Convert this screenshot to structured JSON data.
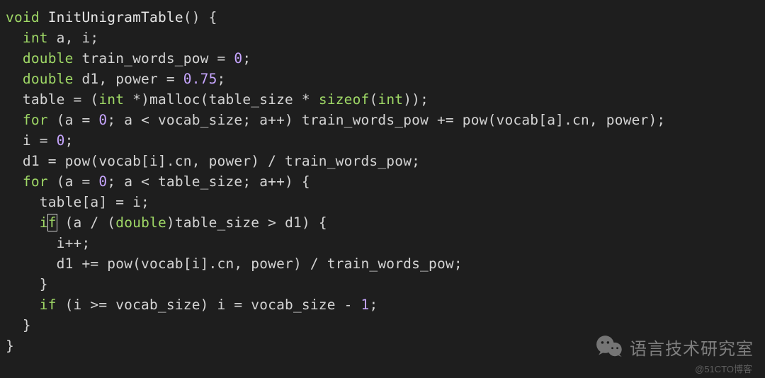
{
  "code": {
    "lines": [
      {
        "indent": 0,
        "tokens": [
          {
            "t": "void",
            "c": "kw"
          },
          {
            "t": " "
          },
          {
            "t": "InitUnigramTable",
            "c": "fn"
          },
          {
            "t": "()",
            "c": "punc"
          },
          {
            "t": " {",
            "c": "punc"
          }
        ]
      },
      {
        "indent": 1,
        "tokens": [
          {
            "t": "int",
            "c": "kw"
          },
          {
            "t": " a, i;"
          }
        ]
      },
      {
        "indent": 1,
        "tokens": [
          {
            "t": "double",
            "c": "kw"
          },
          {
            "t": " train_words_pow = "
          },
          {
            "t": "0",
            "c": "num"
          },
          {
            "t": ";"
          }
        ]
      },
      {
        "indent": 1,
        "tokens": [
          {
            "t": "double",
            "c": "kw"
          },
          {
            "t": " d1, power = "
          },
          {
            "t": "0.75",
            "c": "num"
          },
          {
            "t": ";"
          }
        ]
      },
      {
        "indent": 1,
        "tokens": [
          {
            "t": "table = ("
          },
          {
            "t": "int",
            "c": "kw"
          },
          {
            "t": " *)malloc(table_size * "
          },
          {
            "t": "sizeof",
            "c": "kw"
          },
          {
            "t": "("
          },
          {
            "t": "int",
            "c": "kw"
          },
          {
            "t": "));"
          }
        ]
      },
      {
        "indent": 1,
        "tokens": [
          {
            "t": "for",
            "c": "kw"
          },
          {
            "t": " (a = "
          },
          {
            "t": "0",
            "c": "num"
          },
          {
            "t": "; a < vocab_size; a++) train_words_pow += pow(vocab[a].cn, power);"
          }
        ]
      },
      {
        "indent": 1,
        "tokens": [
          {
            "t": "i = "
          },
          {
            "t": "0",
            "c": "num"
          },
          {
            "t": ";"
          }
        ]
      },
      {
        "indent": 1,
        "tokens": [
          {
            "t": "d1 = pow(vocab[i].cn, power) / train_words_pow;"
          }
        ]
      },
      {
        "indent": 1,
        "tokens": [
          {
            "t": "for",
            "c": "kw"
          },
          {
            "t": " (a = "
          },
          {
            "t": "0",
            "c": "num"
          },
          {
            "t": "; a < table_size; a++) {"
          }
        ]
      },
      {
        "indent": 2,
        "tokens": [
          {
            "t": "table[a] = i;"
          }
        ]
      },
      {
        "indent": 2,
        "tokens": [
          {
            "t": "i",
            "c": "kw"
          },
          {
            "t": "f",
            "c": "kw",
            "cursor": true
          },
          {
            "t": " (a / ("
          },
          {
            "t": "double",
            "c": "kw"
          },
          {
            "t": ")table_size > d1) {"
          }
        ]
      },
      {
        "indent": 3,
        "tokens": [
          {
            "t": "i++;"
          }
        ]
      },
      {
        "indent": 3,
        "tokens": [
          {
            "t": "d1 += pow(vocab[i].cn, power) / train_words_pow;"
          }
        ]
      },
      {
        "indent": 2,
        "tokens": [
          {
            "t": "}"
          }
        ]
      },
      {
        "indent": 2,
        "tokens": [
          {
            "t": "if",
            "c": "kw"
          },
          {
            "t": " (i >= vocab_size) i = vocab_size - "
          },
          {
            "t": "1",
            "c": "num"
          },
          {
            "t": ";"
          }
        ]
      },
      {
        "indent": 1,
        "tokens": [
          {
            "t": "}"
          }
        ]
      },
      {
        "indent": 0,
        "tokens": [
          {
            "t": "}"
          }
        ]
      }
    ],
    "indent_unit": "  "
  },
  "watermark": {
    "main": "语言技术研究室",
    "sub": "@51CTO博客"
  }
}
